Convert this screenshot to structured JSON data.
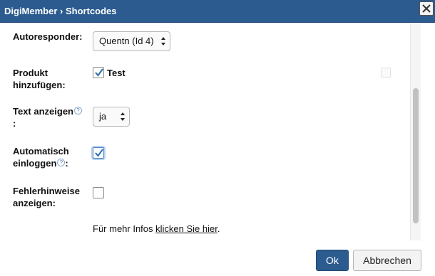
{
  "dialog": {
    "title": "DigiMember › Shortcodes",
    "close_icon": "close-icon"
  },
  "form": {
    "autoresponder": {
      "label": "Autoresponder:",
      "value": "Quentn (Id 4)"
    },
    "produkt": {
      "label_line1": "Produkt",
      "label_line2": "hinzufügen:",
      "option_label": "Test",
      "checked": true
    },
    "text_anzeigen": {
      "label_line1": "Text anzeigen",
      "label_line2": ":",
      "value": "ja",
      "help_icon": "help-icon"
    },
    "auto_login": {
      "label_line1": "Automatisch",
      "label_line2": "einloggen",
      "label_suffix": ":",
      "checked": true,
      "help_icon": "help-icon"
    },
    "fehler": {
      "label_line1": "Fehlerhinweise",
      "label_line2": "anzeigen:",
      "checked": false
    },
    "info": {
      "prefix": "Für mehr Infos ",
      "link": "klicken Sie hier",
      "suffix": "."
    }
  },
  "footer": {
    "ok_label": "Ok",
    "cancel_label": "Abbrechen"
  },
  "colors": {
    "titlebar": "#2b5b8f",
    "ok_button": "#2b5b8f",
    "check": "#2a6db0"
  }
}
